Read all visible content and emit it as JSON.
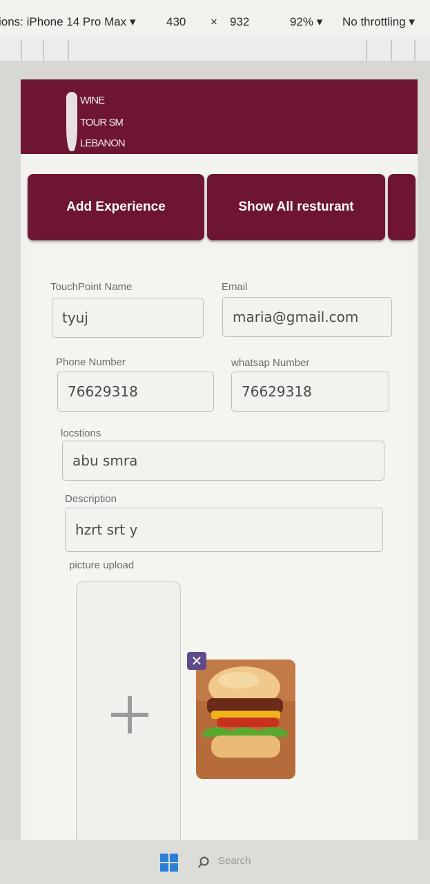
{
  "devtools": {
    "device": "ions: iPhone 14 Pro Max ▾",
    "width": "430",
    "times": "×",
    "height": "932",
    "zoom": "92% ▾",
    "throttle": "No throttling ▾"
  },
  "logo": {
    "line1": "WINE",
    "line2": "TOUR SM",
    "line3": "LEBANON"
  },
  "buttons": {
    "add": "Add Experience",
    "show": "Show All resturant"
  },
  "form": {
    "name_label": "TouchPoint Name",
    "name_value": "tyuj",
    "email_label": "Email",
    "email_value": "maria@gmail.com",
    "phone_label": "Phone Number",
    "phone_value": "76629318",
    "whatsapp_label": "whatsap Number",
    "whatsapp_value": "76629318",
    "location_label": "locstions",
    "location_value": "abu smra",
    "description_label": "Description",
    "description_value": "hzrt srt y",
    "picture_label": "picture upload",
    "remove_glyph": "✕"
  },
  "taskbar": {
    "search": "Search"
  },
  "colors": {
    "brand": "#6e1531",
    "remove": "#5f4a8c"
  },
  "icons": [
    "windows-start-icon",
    "search-icon",
    "plus-icon",
    "close-icon"
  ]
}
